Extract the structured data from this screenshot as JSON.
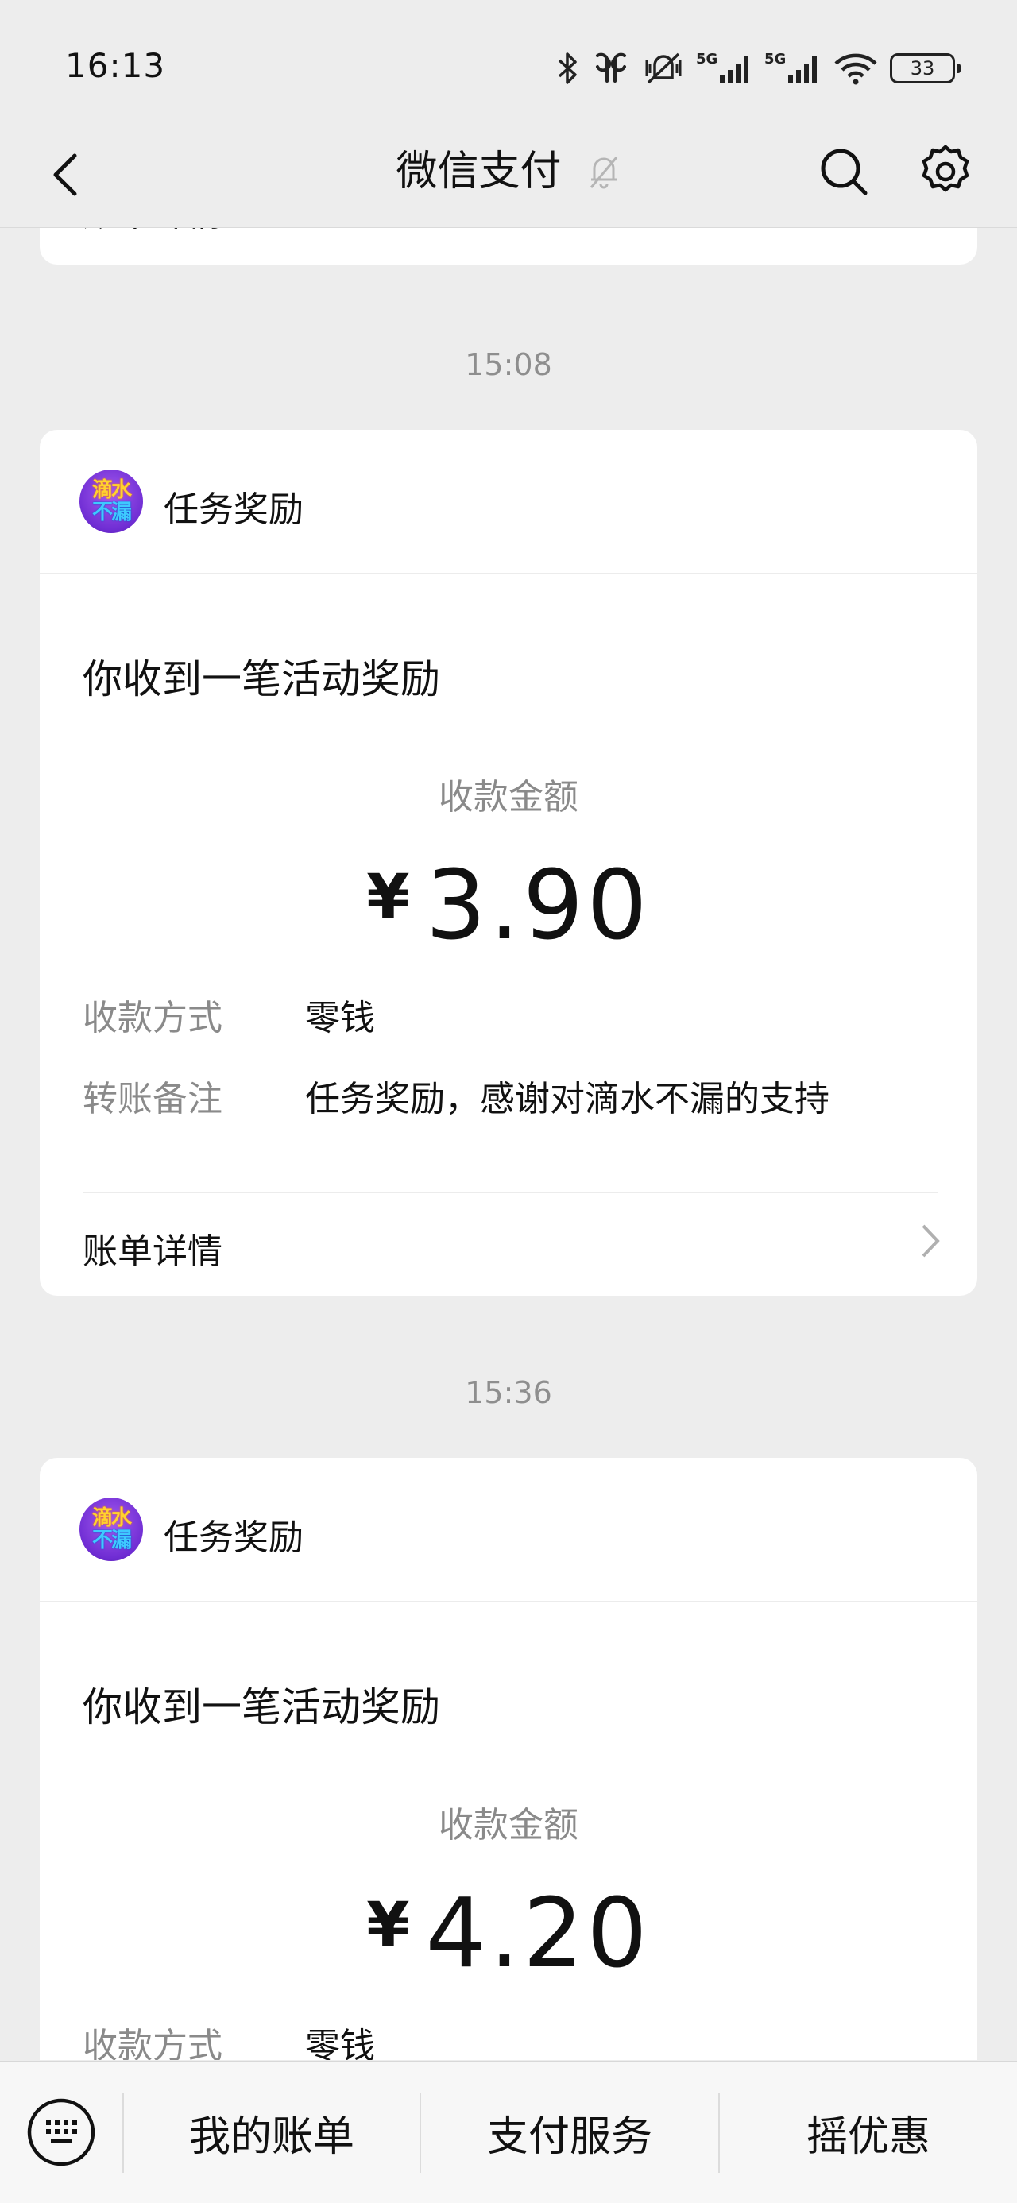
{
  "status_bar": {
    "time": "16:13",
    "battery": "33",
    "icons": [
      "bluetooth-icon",
      "earbuds-icon",
      "mute-vibrate-icon",
      "signal-5g-icon",
      "signal-5g-icon",
      "wifi-icon",
      "battery-icon"
    ]
  },
  "nav": {
    "title": "微信支付",
    "icons": [
      "back-icon",
      "bell-muted-icon",
      "search-icon",
      "gear-icon"
    ]
  },
  "partial_card": {
    "detail_label": "账单详情"
  },
  "messages": [
    {
      "time": "15:08",
      "sender": "任务奖励",
      "logo_text": [
        "滴水",
        "不漏"
      ],
      "title": "你收到一笔活动奖励",
      "amount_label": "收款金额",
      "currency": "¥",
      "amount": "3.90",
      "rows": [
        {
          "label": "收款方式",
          "value": "零钱"
        },
        {
          "label": "转账备注",
          "value": "任务奖励，感谢对滴水不漏的支持"
        }
      ],
      "detail_label": "账单详情"
    },
    {
      "time": "15:36",
      "sender": "任务奖励",
      "logo_text": [
        "滴水",
        "不漏"
      ],
      "title": "你收到一笔活动奖励",
      "amount_label": "收款金额",
      "currency": "¥",
      "amount": "4.20",
      "rows": [
        {
          "label": "收款方式",
          "value": "零钱"
        }
      ]
    }
  ],
  "bottom_menu": {
    "items": [
      "我的账单",
      "支付服务",
      "摇优惠"
    ]
  },
  "colors": {
    "background": "#ededed",
    "card": "#ffffff",
    "muted_text": "#8a8a8a"
  }
}
